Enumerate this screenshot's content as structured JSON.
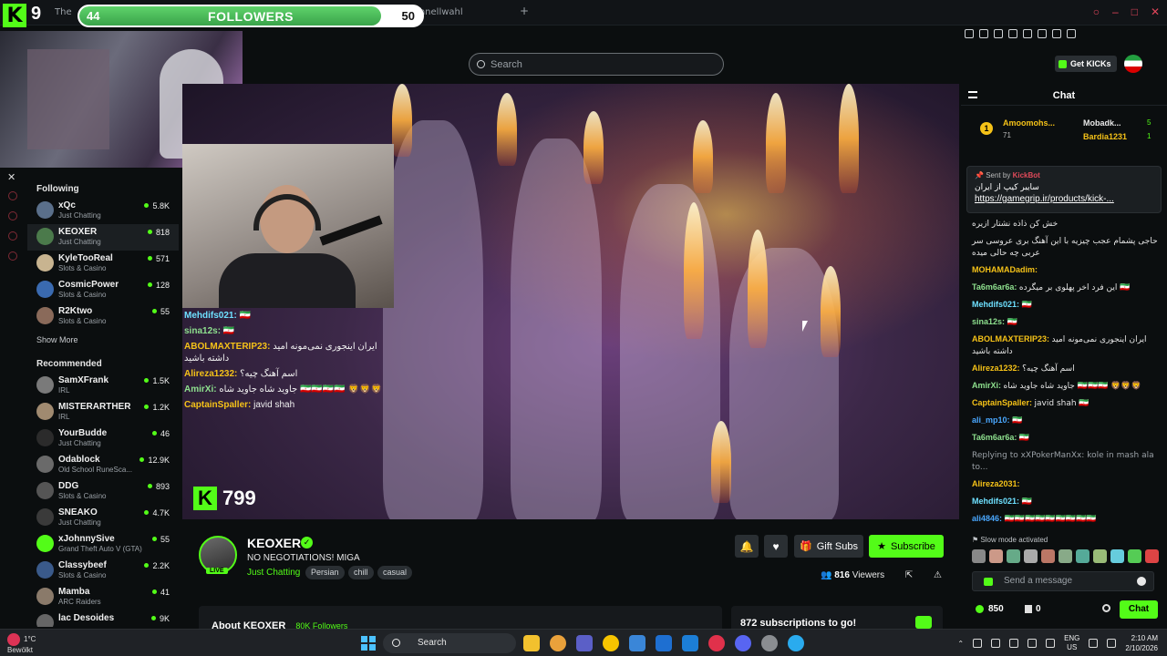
{
  "browser": {
    "tab_1": "The",
    "tab_2": "Schnellwahl",
    "tab_close_mark": "✕",
    "new_tab": "+"
  },
  "brand": {
    "logo_letter": "K",
    "number": "9"
  },
  "followers_bar": {
    "current": "44",
    "title": "FOLLOWERS",
    "goal": "50",
    "progress": 0.88
  },
  "search": {
    "placeholder": "Search"
  },
  "sidebar": {
    "following_title": "Following",
    "following": [
      {
        "name": "xQc",
        "category": "Just Chatting",
        "viewers": "5.8K",
        "color": "#5a6f8a"
      },
      {
        "name": "KEOXER",
        "category": "Just Chatting",
        "viewers": "818",
        "color": "#4b7a4b"
      },
      {
        "name": "KyleTooReal",
        "category": "Slots & Casino",
        "viewers": "571",
        "color": "#c8b490"
      },
      {
        "name": "CosmicPower",
        "category": "Slots & Casino",
        "viewers": "128",
        "color": "#3a6ab0"
      },
      {
        "name": "R2Ktwo",
        "category": "Slots & Casino",
        "viewers": "55",
        "color": "#8a6a5a"
      }
    ],
    "show_more": "Show More",
    "recommended_title": "Recommended",
    "recommended": [
      {
        "name": "SamXFrank",
        "category": "IRL",
        "viewers": "1.5K",
        "color": "#7a7a7a"
      },
      {
        "name": "MISTERARTHER",
        "category": "IRL",
        "viewers": "1.2K",
        "color": "#a08a70"
      },
      {
        "name": "YourBudde",
        "category": "Just Chatting",
        "viewers": "46",
        "color": "#2b2b2b"
      },
      {
        "name": "Odablock",
        "category": "Old School RuneSca...",
        "viewers": "12.9K",
        "color": "#6a6a6a"
      },
      {
        "name": "DDG",
        "category": "Slots & Casino",
        "viewers": "893",
        "color": "#555"
      },
      {
        "name": "SNEAKO",
        "category": "Just Chatting",
        "viewers": "4.7K",
        "color": "#3a3a3a"
      },
      {
        "name": "xJohnnySive",
        "category": "Grand Theft Auto V (GTA)",
        "viewers": "55",
        "color": "#53fc18"
      },
      {
        "name": "Classybeef",
        "category": "Slots & Casino",
        "viewers": "2.2K",
        "color": "#3a5a8a"
      },
      {
        "name": "Mamba",
        "category": "ARC Raiders",
        "viewers": "41",
        "color": "#8a7a6a"
      },
      {
        "name": "lac Desoides",
        "category": "",
        "viewers": "9K",
        "color": "#666"
      }
    ]
  },
  "overlay_chat": [
    {
      "user": "Mehdifs021:",
      "msg": "🇮🇷",
      "color": "#6ee0ff"
    },
    {
      "user": "sina12s:",
      "msg": "🇮🇷",
      "color": "#8ee08e"
    },
    {
      "user": "ABOLMAXTERIP23:",
      "msg": "ایران اینجوری نمی‌مونه امید داشته باشید",
      "color": "#f5c218"
    },
    {
      "user": "Alireza1232:",
      "msg": "اسم آهنگ چیه؟",
      "color": "#f5c218"
    },
    {
      "user": "AmirXi:",
      "msg": "جاوید شاه جاوید شاه 🇮🇷🇮🇷🇮🇷🇮🇷 🦁🦁🦁",
      "color": "#8ee08e"
    },
    {
      "user": "CaptainSpaller:",
      "msg": "javid shah",
      "color": "#f5c218"
    }
  ],
  "overlay_count": "799",
  "channel": {
    "name": "KEOXER",
    "live": "LIVE",
    "title": "NO NEGOTIATIONS! MIGA",
    "category": "Just Chatting",
    "tags": [
      "Persian",
      "chill",
      "casual"
    ],
    "viewers_count": "816",
    "viewers_label": "Viewers",
    "gift_label": "Gift Subs",
    "subscribe_label": "Subscribe",
    "about": "About KEOXER",
    "followers_count": "80K Followers",
    "subs_goal": "872 subscriptions to go!"
  },
  "chat": {
    "title": "Chat",
    "get_kicks": "Get KICKs",
    "leaders": [
      {
        "rank": "1",
        "name": "Amoomohs...",
        "count": "71"
      },
      {
        "name": "Mobadk...",
        "count": "5"
      },
      {
        "name": "Bardia1231",
        "count": "1"
      }
    ],
    "pinned": {
      "sent_by_label": "Sent by",
      "sent_by_user": "KickBot",
      "line1": "سایبر کیپ از ایران",
      "line2": "https://gamegrip.ir/products/kick-..."
    },
    "messages": [
      {
        "user": "",
        "msg": "خش کن ذاذه نشتار ازیره",
        "color": "#e6e6e6"
      },
      {
        "user": "",
        "msg": "حاجی پشمام عجب چیزیه با این آهنگ بری عروسی سر عربی چه حالی میده",
        "color": "#e6e6e6"
      },
      {
        "user": "MOHAMADadim:",
        "msg": "",
        "color": "#f5c218"
      },
      {
        "user": "Ta6m6ar6a:",
        "msg": "این فرد اخر پهلوی بر میگرده 🇮🇷",
        "color": "#8ee08e"
      },
      {
        "user": "Mehdifs021:",
        "msg": "🇮🇷",
        "color": "#6ee0ff"
      },
      {
        "user": "sina12s:",
        "msg": "🇮🇷",
        "color": "#8ee08e"
      },
      {
        "user": "ABOLMAXTERIP23:",
        "msg": "ایران اینجوری نمی‌مونه امید داشته باشید",
        "color": "#f5c218"
      },
      {
        "user": "Alireza1232:",
        "msg": "اسم آهنگ چیه؟",
        "color": "#f5c218"
      },
      {
        "user": "AmirXi:",
        "msg": "جاوید شاه جاوید شاه 🇮🇷🇮🇷🇮🇷 🦁🦁🦁",
        "color": "#8ee08e"
      },
      {
        "user": "CaptainSpaller:",
        "msg": "javid shah 🇮🇷",
        "color": "#f5c218"
      },
      {
        "user": "ali_mp10:",
        "msg": "🇮🇷",
        "color": "#4aa8ff"
      },
      {
        "user": "Ta6m6ar6a:",
        "msg": "🇮🇷",
        "color": "#8ee08e"
      },
      {
        "user": "",
        "msg": "Replying to xXPokerManXx: kole in mash ala to...",
        "color": "#9aa0a6"
      },
      {
        "user": "Alireza2031:",
        "msg": "",
        "color": "#f5c218"
      },
      {
        "user": "Mehdifs021:",
        "msg": "🇮🇷",
        "color": "#6ee0ff"
      },
      {
        "user": "ali4846:",
        "msg": "🇮🇷🇮🇷🇮🇷🇮🇷🇮🇷🇮🇷🇮🇷🇮🇷🇮🇷",
        "color": "#4aa8ff"
      }
    ],
    "slow_mode": "Slow mode activated",
    "input_placeholder": "Send a message",
    "points": "850",
    "kicks": "0",
    "send_label": "Chat"
  },
  "taskbar": {
    "temp": "1°C",
    "weather": "Bewölkt",
    "search": "Search",
    "lang": "ENG",
    "region": "US",
    "time": "2:10 AM",
    "date": "2/10/2026"
  }
}
